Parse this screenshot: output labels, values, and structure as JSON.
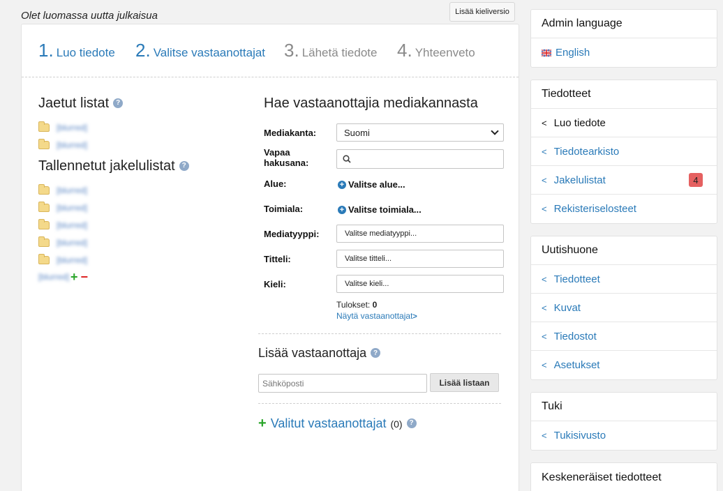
{
  "page": {
    "heading": "Olet luomassa uutta julkaisua",
    "add_language_button": "Lisää kieliversio"
  },
  "steps": [
    {
      "num": "1.",
      "label": "Luo tiedote"
    },
    {
      "num": "2.",
      "label": "Valitse vastaanottajat"
    },
    {
      "num": "3.",
      "label": "Lähetä tiedote"
    },
    {
      "num": "4.",
      "label": "Yhteenveto"
    }
  ],
  "left": {
    "shared_lists_title": "Jaetut listat",
    "shared_lists": [
      "[blurred]",
      "[blurred]"
    ],
    "saved_lists_title": "Tallennetut jakelulistat",
    "saved_lists": [
      "[blurred]",
      "[blurred]",
      "[blurred]",
      "[blurred]",
      "[blurred]"
    ],
    "saved_extra": "[blurred]",
    "help_glyph": "?",
    "plus_glyph": "+",
    "minus_glyph": "−"
  },
  "search": {
    "title": "Hae vastaanottajia mediakannasta",
    "media_db_label": "Mediakanta:",
    "media_db_value": "Suomi",
    "free_search_label_1": "Vapaa",
    "free_search_label_2": "hakusana:",
    "region_label": "Alue:",
    "region_link": "Valitse alue...",
    "industry_label": "Toimiala:",
    "industry_link": "Valitse toimiala...",
    "media_type_label": "Mediatyyppi:",
    "media_type_button": "Valitse mediatyyppi...",
    "title_label": "Titteli:",
    "title_button": "Valitse titteli...",
    "language_label": "Kieli:",
    "language_button": "Valitse kieli...",
    "results_label": "Tulokset:",
    "results_count": "0",
    "show_recipients_link": "Näytä vastaanottajat",
    "add_glyph": "+"
  },
  "add_recipient": {
    "title": "Lisää vastaanottaja",
    "email_placeholder": "Sähköposti",
    "add_button": "Lisää listaan"
  },
  "selected": {
    "title": "Valitut vastaanottajat",
    "count": "(0)"
  },
  "sidebar": {
    "admin_language": {
      "title": "Admin language",
      "item": "English"
    },
    "releases": {
      "title": "Tiedotteet",
      "items": [
        {
          "label": "Luo tiedote"
        },
        {
          "label": "Tiedotearkisto"
        },
        {
          "label": "Jakelulistat",
          "badge": "4"
        },
        {
          "label": "Rekisteriselosteet"
        }
      ]
    },
    "newsroom": {
      "title": "Uutishuone",
      "items": [
        {
          "label": "Tiedotteet"
        },
        {
          "label": "Kuvat"
        },
        {
          "label": "Tiedostot"
        },
        {
          "label": "Asetukset"
        }
      ]
    },
    "support": {
      "title": "Tuki",
      "items": [
        {
          "label": "Tukisivusto"
        }
      ]
    },
    "drafts": {
      "title": "Keskeneräiset tiedotteet"
    }
  },
  "colors": {
    "accent": "#2a7ab8",
    "badge": "#e56060",
    "inactive_step": "#8a8a8a"
  }
}
